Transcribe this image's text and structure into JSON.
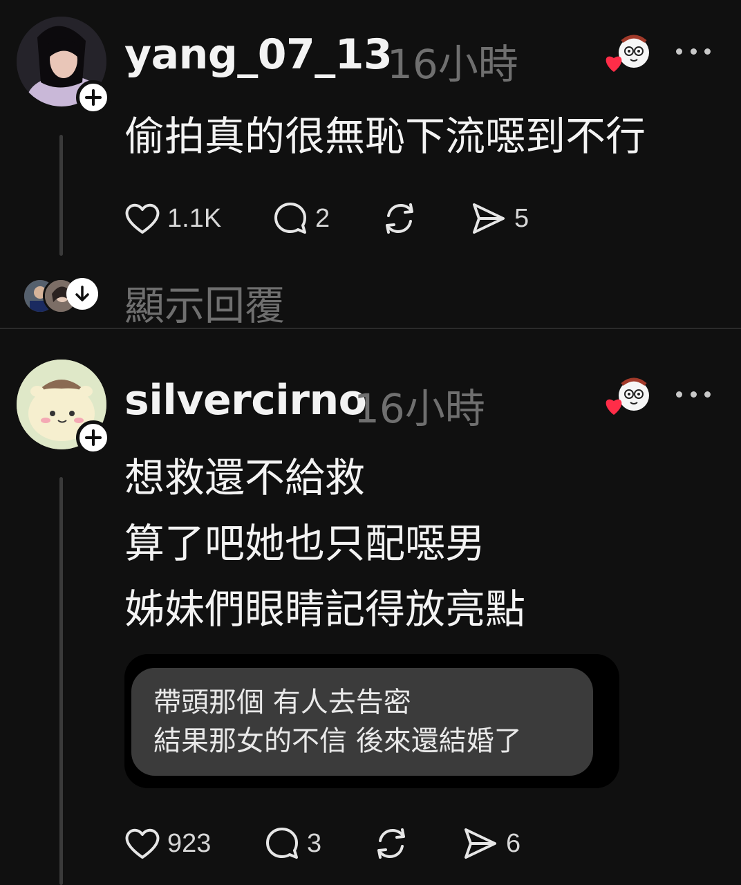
{
  "posts": [
    {
      "username": "yang_07_13",
      "time": "16小時",
      "text_lines": [
        "偷拍真的很無恥下流噁到不行"
      ],
      "likes": "1.1K",
      "comments": "2",
      "shares": "5",
      "show_replies": "顯示回覆"
    },
    {
      "username": "silvercirno",
      "time": "16小時",
      "text_lines": [
        "想救還不給救",
        "算了吧她也只配噁男",
        "姊妹們眼睛記得放亮點"
      ],
      "embed_lines": [
        "帶頭那個 有人去告密",
        "結果那女的不信 後來還結婚了"
      ],
      "likes": "923",
      "comments": "3",
      "shares": "6"
    }
  ],
  "colors": {
    "background": "#101010",
    "text": "#f3f3f3",
    "muted": "#6f6f6f",
    "heart": "#ff2d48"
  },
  "icons": [
    "heart-icon",
    "comment-icon",
    "repost-icon",
    "send-icon",
    "more-icon",
    "plus-icon",
    "arrow-down-icon"
  ]
}
